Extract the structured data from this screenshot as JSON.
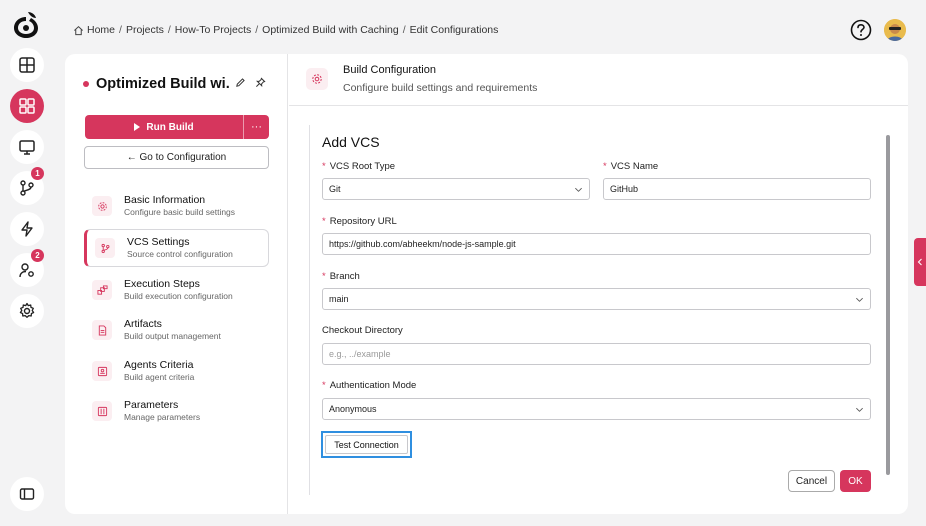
{
  "breadcrumb": [
    {
      "label": "Home"
    },
    {
      "label": "Projects"
    },
    {
      "label": "How-To Projects"
    },
    {
      "label": "Optimized Build with Caching"
    },
    {
      "label": "Edit Configurations"
    }
  ],
  "rail": {
    "badges": {
      "vcs": "1",
      "agents": "2"
    }
  },
  "project": {
    "title": "Optimized Build wi...",
    "run_label": "Run Build",
    "more_label": "···",
    "goto_label": "← Go to Configuration"
  },
  "nav": [
    {
      "label": "Basic Information",
      "sub": "Configure basic build settings"
    },
    {
      "label": "VCS Settings",
      "sub": "Source control configuration"
    },
    {
      "label": "Execution Steps",
      "sub": "Build execution configuration"
    },
    {
      "label": "Artifacts",
      "sub": "Build output management"
    },
    {
      "label": "Agents Criteria",
      "sub": "Build agent criteria"
    },
    {
      "label": "Parameters",
      "sub": "Manage parameters"
    }
  ],
  "header": {
    "title": "Build Configuration",
    "subtitle": "Configure build settings and requirements"
  },
  "form": {
    "title": "Add VCS",
    "required_mark": "*",
    "vcs_root_type": {
      "label": "VCS Root Type",
      "value": "Git"
    },
    "vcs_name": {
      "label": "VCS Name",
      "value": "GitHub"
    },
    "repo_url": {
      "label": "Repository URL",
      "value": "https://github.com/abheekm/node-js-sample.git"
    },
    "branch": {
      "label": "Branch",
      "value": "main"
    },
    "checkout_dir": {
      "label": "Checkout Directory",
      "placeholder": "e.g., ../example"
    },
    "auth_mode": {
      "label": "Authentication Mode",
      "value": "Anonymous"
    },
    "test_label": "Test Connection",
    "cancel_label": "Cancel",
    "ok_label": "OK"
  },
  "colors": {
    "accent": "#d6365d",
    "focus": "#2f8fe0"
  }
}
